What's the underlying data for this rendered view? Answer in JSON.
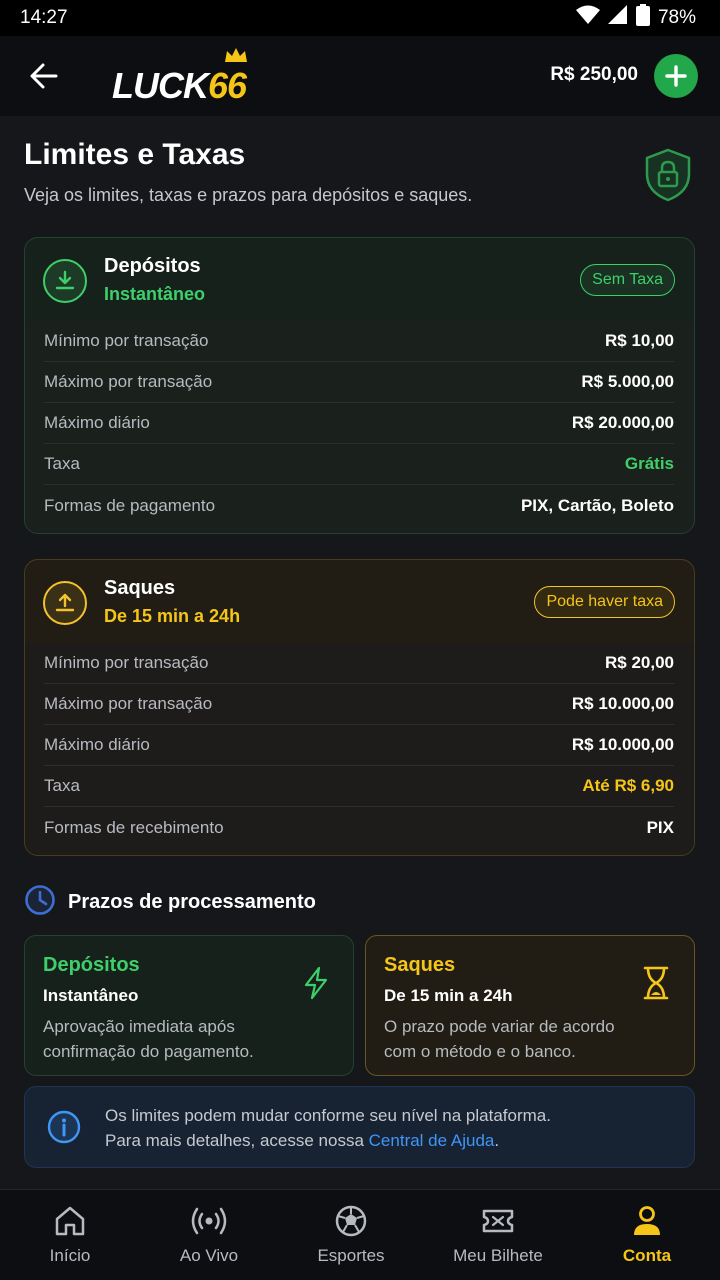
{
  "status": {
    "time": "14:27",
    "battery": "78%"
  },
  "header": {
    "logo_text": "LUCK",
    "logo_num": "66",
    "balance": "R$ 250,00"
  },
  "page": {
    "title": "Limites e Taxas",
    "subtitle": "Veja os limites, taxas e prazos para depósitos e saques."
  },
  "deposits": {
    "title": "Depósitos",
    "subtitle": "Instantâneo",
    "badge": "Sem Taxa",
    "rows": [
      {
        "label": "Mínimo por transação",
        "value": "R$ 10,00"
      },
      {
        "label": "Máximo por transação",
        "value": "R$ 5.000,00"
      },
      {
        "label": "Máximo diário",
        "value": "R$ 20.000,00"
      },
      {
        "label": "Taxa",
        "value": "Grátis"
      },
      {
        "label": "Formas de pagamento",
        "value": "PIX, Cartão, Boleto"
      }
    ]
  },
  "withdrawals": {
    "title": "Saques",
    "subtitle": "De 15 min a 24h",
    "badge": "Pode haver taxa",
    "rows": [
      {
        "label": "Mínimo por transação",
        "value": "R$ 20,00"
      },
      {
        "label": "Máximo por transação",
        "value": "R$ 10.000,00"
      },
      {
        "label": "Máximo diário",
        "value": "R$ 10.000,00"
      },
      {
        "label": "Taxa",
        "value": "Até R$ 6,90"
      },
      {
        "label": "Formas de recebimento",
        "value": "PIX"
      }
    ]
  },
  "processing": {
    "title": "Prazos de processamento",
    "deposits": {
      "title": "Depósitos",
      "subtitle": "Instantâneo",
      "line1": "Aprovação imediata após",
      "line2": "confirmação do pagamento."
    },
    "withdrawals": {
      "title": "Saques",
      "subtitle": "De 15 min a 24h",
      "line1": "O prazo pode variar de acordo",
      "line2": "com o método e o banco."
    }
  },
  "info": {
    "line1": "Os limites podem mudar conforme seu nível na plataforma.",
    "line2_prefix": "Para mais detalhes, acesse nossa ",
    "link": "Central de Ajuda",
    "line2_suffix": "."
  },
  "nav": {
    "items": [
      {
        "label": "Início"
      },
      {
        "label": "Ao Vivo"
      },
      {
        "label": "Esportes"
      },
      {
        "label": "Meu Bilhete"
      },
      {
        "label": "Conta"
      }
    ]
  },
  "colors": {
    "accent": "#f5c518",
    "success": "#3fcf6a",
    "link": "#3f97f5",
    "add_button": "#22a74a"
  }
}
